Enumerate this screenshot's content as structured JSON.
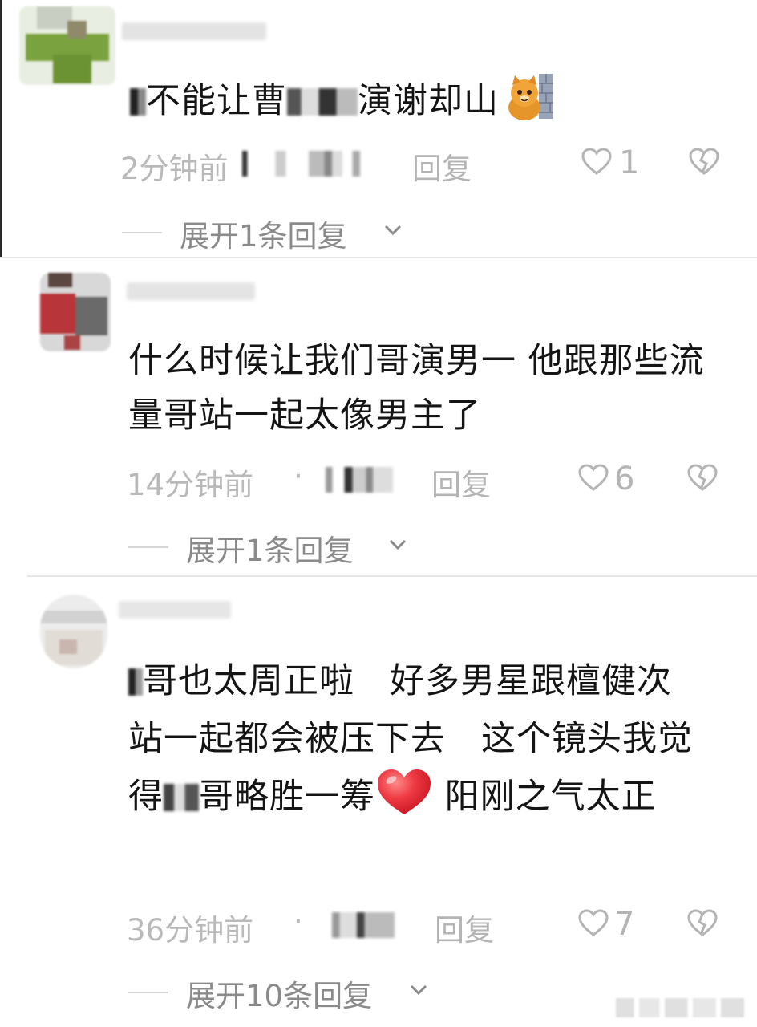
{
  "comments": [
    {
      "text_before": "能",
      "text_middle": "不能让曹",
      "text_after": "演谢却山",
      "time": "2分钟前",
      "reply_label": "回复",
      "like_count": "1",
      "expand_label": "展开1条回复"
    },
    {
      "text": "什么时候让我们哥演男一 他跟那些流量哥站一起太像男主了",
      "time": "14分钟前",
      "dot": "·",
      "reply_label": "回复",
      "like_count": "6",
      "expand_label": "展开1条回复"
    },
    {
      "text_start": "哥也太周正啦　好多男星跟檀健次站一起都会被压下去　这个镜头我觉得",
      "text_mid": "哥略胜一筹",
      "text_end": " 阳刚之气太正",
      "time": "36分钟前",
      "dot": "·",
      "reply_label": "回复",
      "like_count": "7",
      "expand_label": "展开10条回复"
    }
  ],
  "icons": {
    "like": "heart-outline-icon",
    "dislike": "broken-heart-icon",
    "expand": "chevron-down-icon"
  },
  "colors": {
    "meta_text": "#b9b9b9",
    "comment_text": "#141414",
    "heart_emoji": "#e5303a"
  }
}
